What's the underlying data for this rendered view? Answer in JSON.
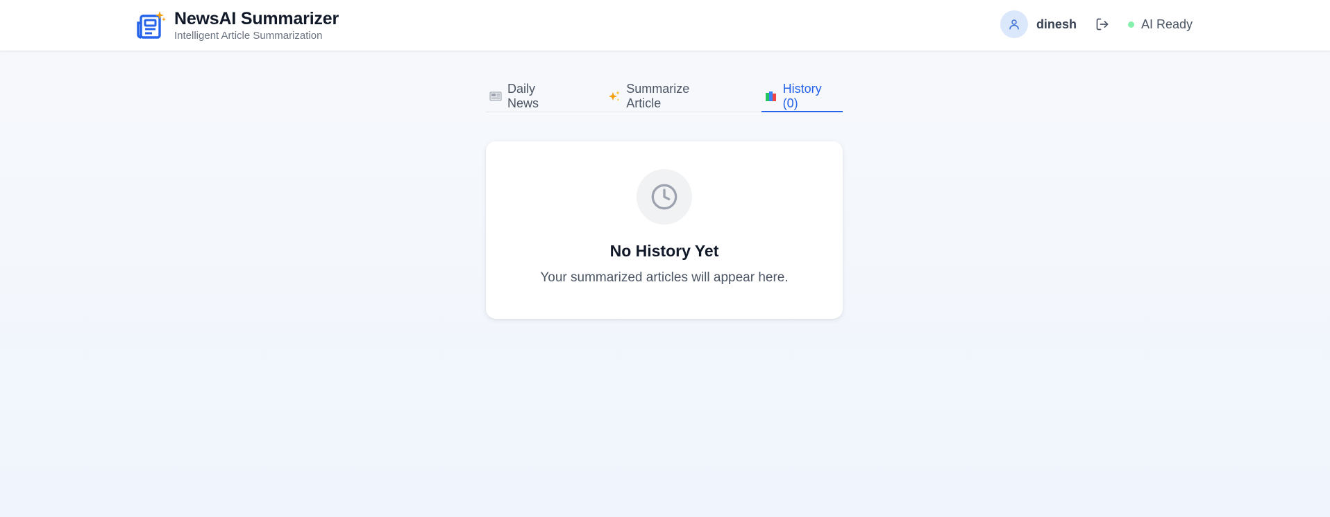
{
  "header": {
    "title": "NewsAI Summarizer",
    "subtitle": "Intelligent Article Summarization",
    "logo_icon": "newspaper-sparkle-icon",
    "user": {
      "name": "dinesh",
      "avatar_icon": "user-icon"
    },
    "logout_icon": "logout-icon",
    "status": {
      "label": "AI Ready",
      "color": "#86efac"
    }
  },
  "tabs": [
    {
      "label": "Daily News",
      "icon": "newspaper-icon",
      "active": false
    },
    {
      "label": "Summarize Article",
      "icon": "sparkles-icon",
      "active": false
    },
    {
      "label": "History (0)",
      "icon": "books-icon",
      "active": true
    }
  ],
  "empty_state": {
    "icon": "clock-icon",
    "title": "No History Yet",
    "message": "Your summarized articles will appear here."
  },
  "colors": {
    "accent": "#2563eb",
    "brand_blue": "#2563eb",
    "background": "#f3f6fc"
  }
}
